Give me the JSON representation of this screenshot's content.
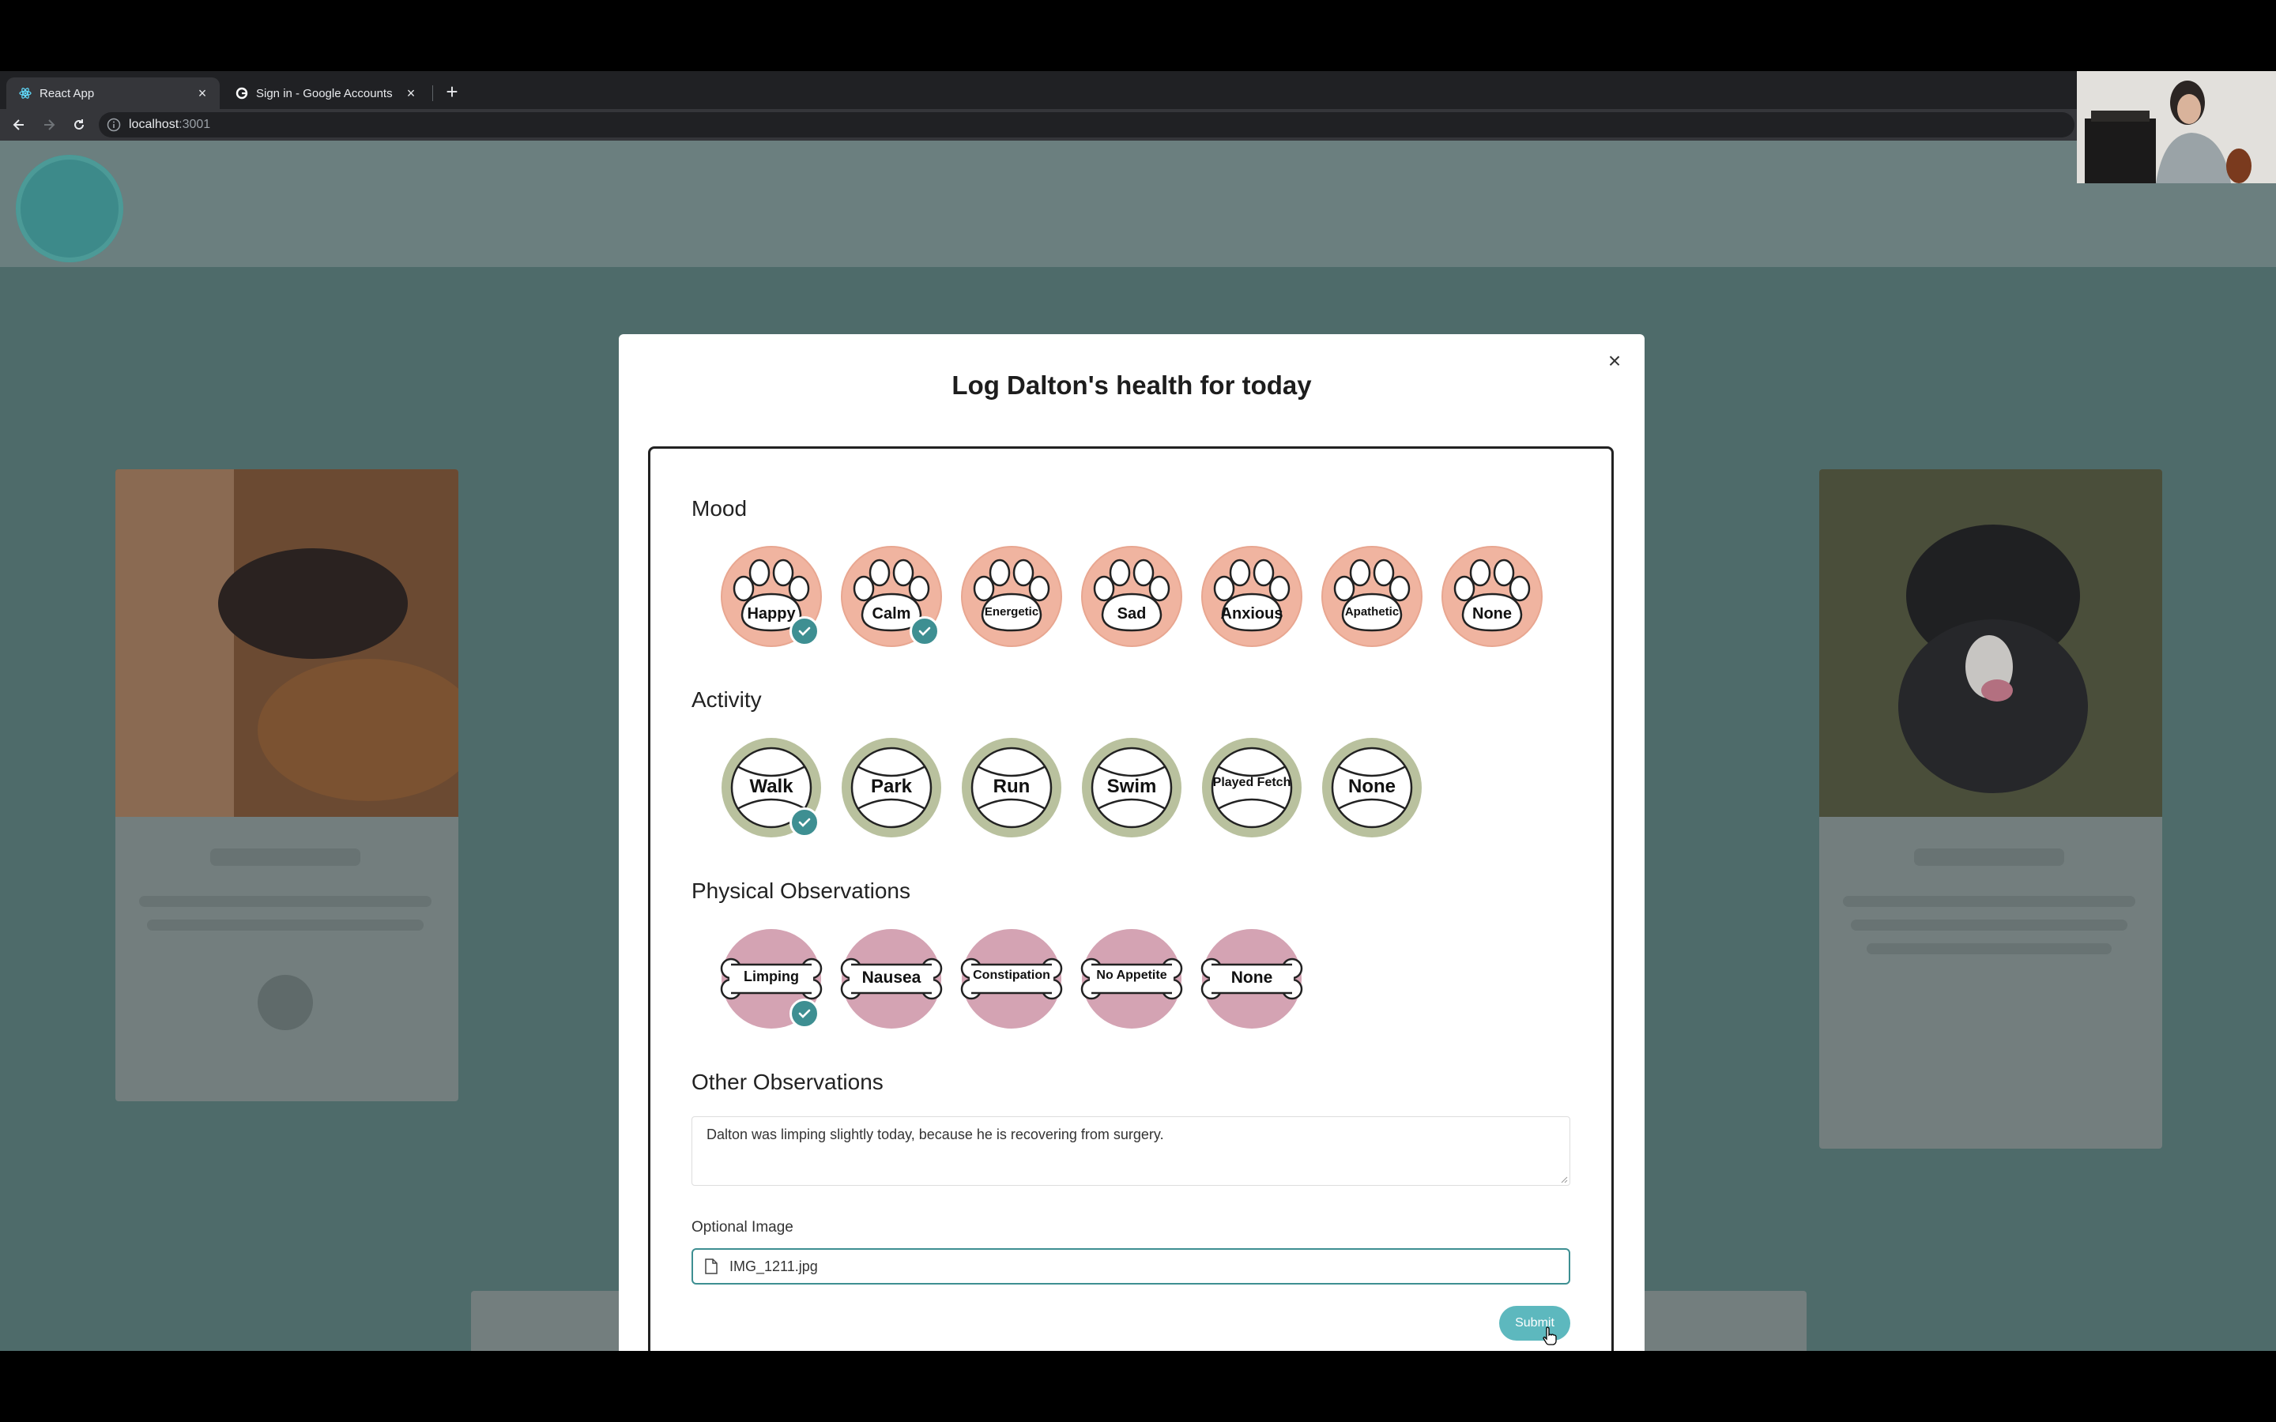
{
  "browser": {
    "tabs": [
      {
        "title": "React App",
        "active": true
      },
      {
        "title": "Sign in - Google Accounts",
        "active": false
      }
    ],
    "url_host": "localhost",
    "url_port": ":3001"
  },
  "modal": {
    "title": "Log Dalton's health for today",
    "close": "×"
  },
  "mood": {
    "label": "Mood",
    "options": [
      {
        "label": "Happy",
        "selected": true
      },
      {
        "label": "Calm",
        "selected": true
      },
      {
        "label": "Energetic",
        "selected": false
      },
      {
        "label": "Sad",
        "selected": false
      },
      {
        "label": "Anxious",
        "selected": false
      },
      {
        "label": "Apathetic",
        "selected": false
      },
      {
        "label": "None",
        "selected": false
      }
    ]
  },
  "activity": {
    "label": "Activity",
    "options": [
      {
        "label": "Walk",
        "selected": true
      },
      {
        "label": "Park",
        "selected": false
      },
      {
        "label": "Run",
        "selected": false
      },
      {
        "label": "Swim",
        "selected": false
      },
      {
        "label": "Played Fetch",
        "selected": false
      },
      {
        "label": "None",
        "selected": false
      }
    ]
  },
  "physical": {
    "label": "Physical Observations",
    "options": [
      {
        "label": "Limping",
        "selected": true
      },
      {
        "label": "Nausea",
        "selected": false
      },
      {
        "label": "Constipation",
        "selected": false
      },
      {
        "label": "No Appetite",
        "selected": false
      },
      {
        "label": "None",
        "selected": false
      }
    ]
  },
  "other": {
    "label": "Other Observations",
    "value": "Dalton was limping slightly today, because he is recovering from surgery."
  },
  "image": {
    "label": "Optional Image",
    "file_name": "IMG_1211.jpg"
  },
  "submit_label": "Submit",
  "colors": {
    "mood": "#f0b4a0",
    "activity": "#b9c19e",
    "physical": "#d4a3b3",
    "check": "#3e8f92",
    "submit": "#5db8be"
  }
}
